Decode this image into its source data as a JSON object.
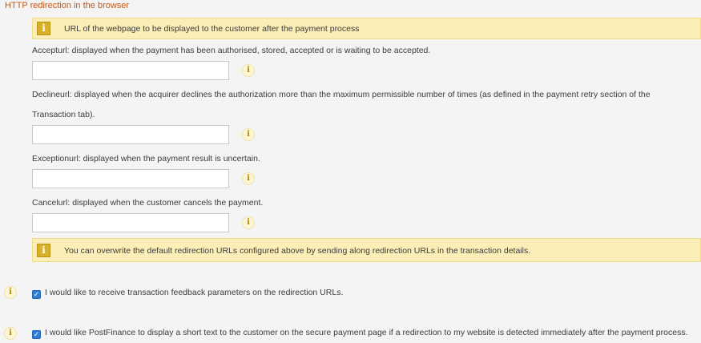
{
  "section_title": "HTTP redirection in the browser",
  "info_top": "URL of the webpage to be displayed to the customer after the payment process",
  "fields": [
    {
      "label": "Accepturl: displayed when the payment has been authorised, stored, accepted or is waiting to be accepted.",
      "value": ""
    },
    {
      "label_line1": "Declineurl: displayed when the acquirer declines the authorization more than the maximum permissible number of times (as defined in the payment retry section of the",
      "label_line2": "Transaction tab).",
      "value": ""
    },
    {
      "label": "Exceptionurl: displayed when the payment result is uncertain.",
      "value": ""
    },
    {
      "label": "Cancelurl: displayed when the customer cancels the payment.",
      "value": ""
    }
  ],
  "info_bottom": "You can overwrite the default redirection URLs configured above by sending along redirection URLs in the transaction details.",
  "checkboxes": [
    {
      "label": "I would like to receive transaction feedback parameters on the redirection URLs.",
      "checked": true
    },
    {
      "label": "I would like PostFinance to display a short text to the customer on the secure payment page if a redirection to my website is detected immediately after the payment process.",
      "checked": true
    }
  ],
  "info_glyph": "i",
  "colors": {
    "title": "#c15a1c",
    "info_bg": "#fbeeb6",
    "checkbox": "#2f7fd3"
  }
}
